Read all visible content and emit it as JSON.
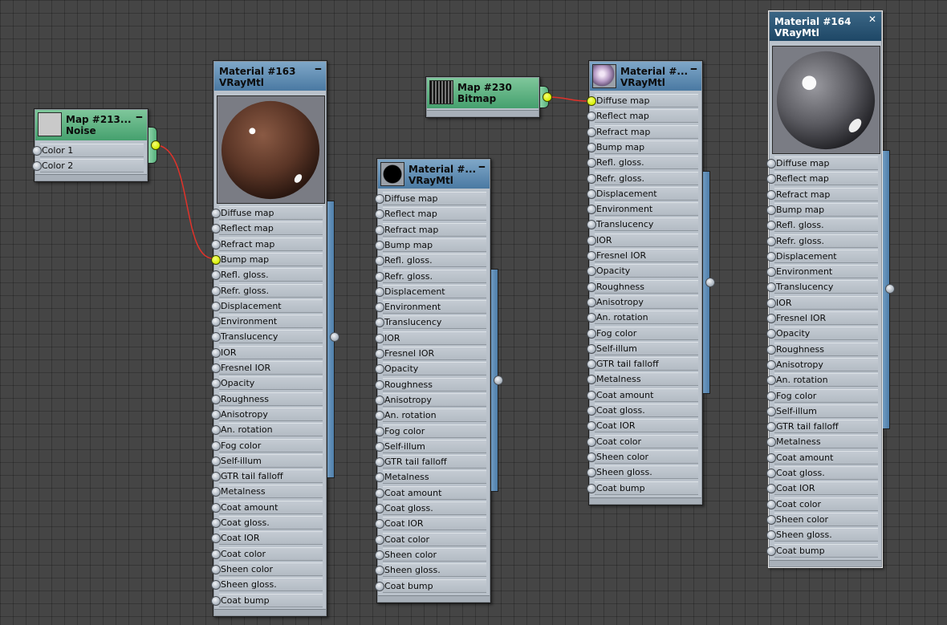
{
  "graph": {
    "wire_color": "#e0322a",
    "linked_socket_color": "#d6ee00",
    "nodes": {
      "noise_map": {
        "title": "Map #213...",
        "type": "Noise",
        "minimize": "━",
        "params": [
          "Color 1",
          "Color 2"
        ]
      },
      "bitmap_map": {
        "title": "Map #230",
        "type": "Bitmap"
      },
      "material_163": {
        "title": "Material #163",
        "type": "VRayMtl",
        "minimize": "━",
        "preview": "brown-glossy-sphere",
        "params": [
          "Diffuse map",
          "Reflect map",
          "Refract map",
          "Bump map",
          "Refl. gloss.",
          "Refr. gloss.",
          "Displacement",
          "Environment",
          "Translucency",
          "IOR",
          "Fresnel IOR",
          "Opacity",
          "Roughness",
          "Anisotropy",
          "An. rotation",
          "Fog color",
          "Self-illum",
          "GTR tail falloff",
          "Metalness",
          "Coat amount",
          "Coat gloss.",
          "Coat IOR",
          "Coat color",
          "Sheen color",
          "Sheen gloss.",
          "Coat bump"
        ]
      },
      "material_black": {
        "title": "Material #...",
        "type": "VRayMtl",
        "minimize": "━",
        "preview": "black-sphere-thumb",
        "params": [
          "Diffuse map",
          "Reflect map",
          "Refract map",
          "Bump map",
          "Refl. gloss.",
          "Refr. gloss.",
          "Displacement",
          "Environment",
          "Translucency",
          "IOR",
          "Fresnel IOR",
          "Opacity",
          "Roughness",
          "Anisotropy",
          "An. rotation",
          "Fog color",
          "Self-illum",
          "GTR tail falloff",
          "Metalness",
          "Coat amount",
          "Coat gloss.",
          "Coat IOR",
          "Coat color",
          "Sheen color",
          "Sheen gloss.",
          "Coat bump"
        ]
      },
      "material_pattern": {
        "title": "Material #...",
        "type": "VRayMtl",
        "minimize": "━",
        "preview": "patterned-sphere-thumb",
        "params": [
          "Diffuse map",
          "Reflect map",
          "Refract map",
          "Bump map",
          "Refl. gloss.",
          "Refr. gloss.",
          "Displacement",
          "Environment",
          "Translucency",
          "IOR",
          "Fresnel IOR",
          "Opacity",
          "Roughness",
          "Anisotropy",
          "An. rotation",
          "Fog color",
          "Self-illum",
          "GTR tail falloff",
          "Metalness",
          "Coat amount",
          "Coat gloss.",
          "Coat IOR",
          "Coat color",
          "Sheen color",
          "Sheen gloss.",
          "Coat bump"
        ]
      },
      "material_164": {
        "title": "Material #164",
        "type": "VRayMtl",
        "preview": "gray-glossy-sphere",
        "params": [
          "Diffuse map",
          "Reflect map",
          "Refract map",
          "Bump map",
          "Refl. gloss.",
          "Refr. gloss.",
          "Displacement",
          "Environment",
          "Translucency",
          "IOR",
          "Fresnel IOR",
          "Opacity",
          "Roughness",
          "Anisotropy",
          "An. rotation",
          "Fog color",
          "Self-illum",
          "GTR tail falloff",
          "Metalness",
          "Coat amount",
          "Coat gloss.",
          "Coat IOR",
          "Coat color",
          "Sheen color",
          "Sheen gloss.",
          "Coat bump"
        ]
      }
    },
    "connections": [
      {
        "from": "noise_map",
        "to": "material_163",
        "param": "Bump map"
      },
      {
        "from": "bitmap_map",
        "to": "material_pattern",
        "param": "Diffuse map"
      }
    ]
  }
}
